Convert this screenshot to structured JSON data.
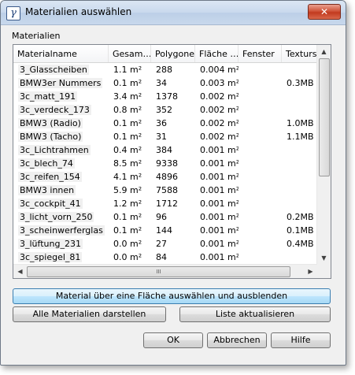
{
  "window": {
    "title": "Materialien auswählen",
    "app_icon": "app-logo-icon",
    "close_glyph": "✕"
  },
  "group_label": "Materialien",
  "columns": [
    "Materialname",
    "Gesam…",
    "Polygone",
    "Fläche …",
    "Fenster",
    "Texturs"
  ],
  "rows": [
    {
      "name": "3_Glasscheiben",
      "gesamt": "1.1 m²",
      "polygone": "288",
      "flaeche": "0.004 m²",
      "fenster": "",
      "textur": ""
    },
    {
      "name": "BMW3er Nummers",
      "gesamt": "0.1 m²",
      "polygone": "34",
      "flaeche": "0.003 m²",
      "fenster": "",
      "textur": "0.3MB"
    },
    {
      "name": "3c_matt_191",
      "gesamt": "3.4 m²",
      "polygone": "1378",
      "flaeche": "0.002 m²",
      "fenster": "",
      "textur": ""
    },
    {
      "name": "3c_verdeck_173",
      "gesamt": "0.8 m²",
      "polygone": "352",
      "flaeche": "0.002 m²",
      "fenster": "",
      "textur": ""
    },
    {
      "name": "BMW3 (Radio)",
      "gesamt": "0.1 m²",
      "polygone": "36",
      "flaeche": "0.002 m²",
      "fenster": "",
      "textur": "1.0MB"
    },
    {
      "name": "BMW3 (Tacho)",
      "gesamt": "0.1 m²",
      "polygone": "31",
      "flaeche": "0.002 m²",
      "fenster": "",
      "textur": "1.1MB"
    },
    {
      "name": "3c_Lichtrahmen",
      "gesamt": "0.4 m²",
      "polygone": "384",
      "flaeche": "0.001 m²",
      "fenster": "",
      "textur": ""
    },
    {
      "name": "3c_blech_74",
      "gesamt": "8.5 m²",
      "polygone": "9338",
      "flaeche": "0.001 m²",
      "fenster": "",
      "textur": ""
    },
    {
      "name": "3c_reifen_154",
      "gesamt": "4.1 m²",
      "polygone": "4896",
      "flaeche": "0.001 m²",
      "fenster": "",
      "textur": ""
    },
    {
      "name": "BMW3 innen",
      "gesamt": "5.9 m²",
      "polygone": "7588",
      "flaeche": "0.001 m²",
      "fenster": "",
      "textur": ""
    },
    {
      "name": "3c_cockpit_41",
      "gesamt": "1.2 m²",
      "polygone": "1712",
      "flaeche": "0.001 m²",
      "fenster": "",
      "textur": ""
    },
    {
      "name": "3_licht_vorn_250",
      "gesamt": "0.1 m²",
      "polygone": "96",
      "flaeche": "0.001 m²",
      "fenster": "",
      "textur": "0.2MB"
    },
    {
      "name": "3_scheinwerferglas",
      "gesamt": "0.1 m²",
      "polygone": "144",
      "flaeche": "0.001 m²",
      "fenster": "",
      "textur": "0.1MB"
    },
    {
      "name": "3_lüftung_231",
      "gesamt": "0.0 m²",
      "polygone": "27",
      "flaeche": "0.001 m²",
      "fenster": "",
      "textur": "0.4MB"
    },
    {
      "name": "3c_spiegel_81",
      "gesamt": "0.0 m²",
      "polygone": "84",
      "flaeche": "0.001 m²",
      "fenster": "",
      "textur": ""
    }
  ],
  "scrollbar": {
    "up": "▲",
    "down": "▼",
    "left": "◀",
    "right": "▶",
    "grip": "III"
  },
  "buttons": {
    "select_hide": "Material über eine Fläche auswählen und ausblenden",
    "show_all": "Alle Materialien darstellen",
    "refresh": "Liste aktualisieren",
    "ok": "OK",
    "cancel": "Abbrechen",
    "help": "Hilfe"
  }
}
